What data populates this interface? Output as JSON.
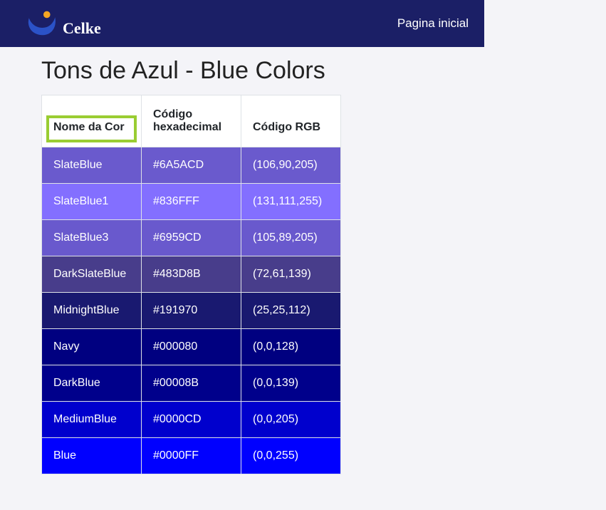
{
  "brand": {
    "name": "Celke"
  },
  "nav": {
    "home": "Pagina inicial"
  },
  "page": {
    "title": "Tons de Azul - Blue Colors"
  },
  "table": {
    "headers": {
      "name": "Nome da Cor",
      "hex": "Código hexadecimal",
      "rgb": "Código RGB"
    },
    "rows": [
      {
        "name": "SlateBlue",
        "hex": "#6A5ACD",
        "rgb": "(106,90,205)",
        "bg": "#6A5ACD"
      },
      {
        "name": "SlateBlue1",
        "hex": "#836FFF",
        "rgb": "(131,111,255)",
        "bg": "#836FFF"
      },
      {
        "name": "SlateBlue3",
        "hex": "#6959CD",
        "rgb": "(105,89,205)",
        "bg": "#6959CD"
      },
      {
        "name": "DarkSlateBlue",
        "hex": "#483D8B",
        "rgb": "(72,61,139)",
        "bg": "#483D8B"
      },
      {
        "name": "MidnightBlue",
        "hex": "#191970",
        "rgb": "(25,25,112)",
        "bg": "#191970"
      },
      {
        "name": "Navy",
        "hex": "#000080",
        "rgb": "(0,0,128)",
        "bg": "#000080"
      },
      {
        "name": "DarkBlue",
        "hex": "#00008B",
        "rgb": "(0,0,139)",
        "bg": "#00008B"
      },
      {
        "name": "MediumBlue",
        "hex": "#0000CD",
        "rgb": "(0,0,205)",
        "bg": "#0000CD"
      },
      {
        "name": "Blue",
        "hex": "#0000FF",
        "rgb": "(0,0,255)",
        "bg": "#0000FF"
      }
    ]
  }
}
